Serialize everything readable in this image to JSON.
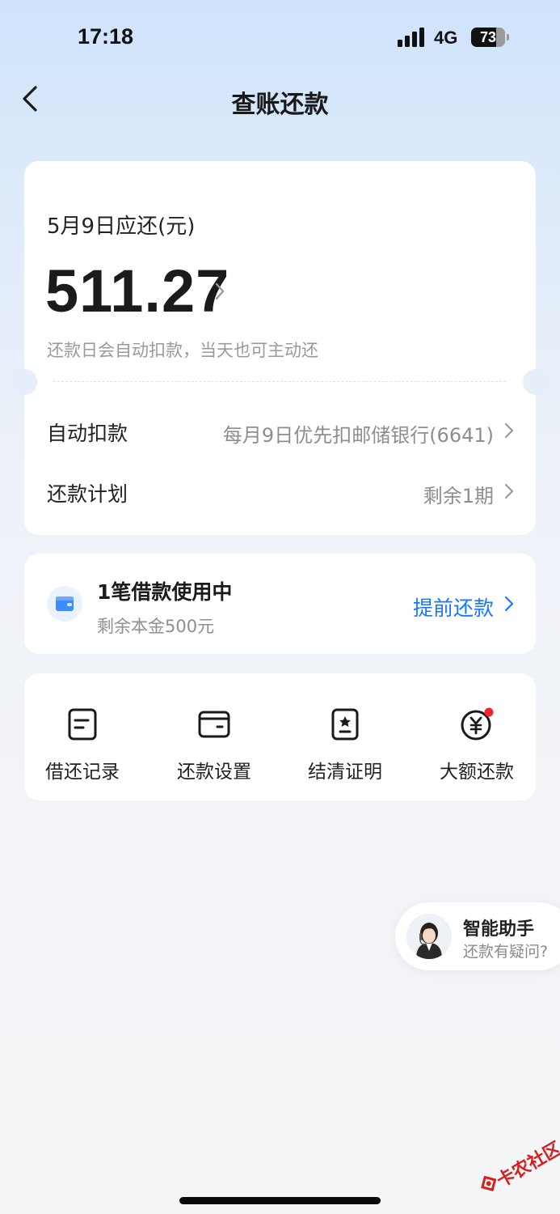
{
  "status_bar": {
    "time": "17:18",
    "network": "4G",
    "battery": "73",
    "battery_level": 0.73
  },
  "nav": {
    "title": "查账还款"
  },
  "bill": {
    "due_label": "5月9日应还(元)",
    "amount": "511.27",
    "hint": "还款日会自动扣款，当天也可主动还",
    "rows": [
      {
        "label": "自动扣款",
        "value": "每月9日优先扣邮储银行(6641)"
      },
      {
        "label": "还款计划",
        "value": "剩余1期"
      }
    ]
  },
  "loan": {
    "title": "1笔借款使用中",
    "subtitle": "剩余本金500元",
    "action": "提前还款"
  },
  "tools": [
    {
      "label": "借还记录",
      "icon": "record-icon"
    },
    {
      "label": "还款设置",
      "icon": "card-icon"
    },
    {
      "label": "结清证明",
      "icon": "certificate-icon"
    },
    {
      "label": "大额还款",
      "icon": "yuan-icon"
    }
  ],
  "assistant": {
    "title": "智能助手",
    "subtitle": "还款有疑问?"
  },
  "watermark": {
    "text": "卡农社区"
  },
  "colors": {
    "accent": "#1677ff",
    "badge": "#f5222d"
  }
}
